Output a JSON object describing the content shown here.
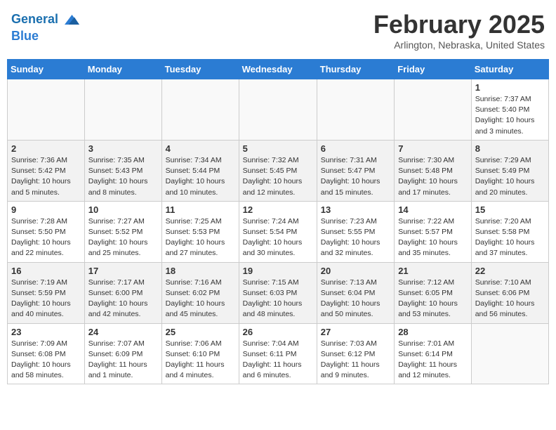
{
  "header": {
    "logo_line1": "General",
    "logo_line2": "Blue",
    "month": "February 2025",
    "location": "Arlington, Nebraska, United States"
  },
  "weekdays": [
    "Sunday",
    "Monday",
    "Tuesday",
    "Wednesday",
    "Thursday",
    "Friday",
    "Saturday"
  ],
  "weeks": [
    [
      {
        "day": "",
        "info": ""
      },
      {
        "day": "",
        "info": ""
      },
      {
        "day": "",
        "info": ""
      },
      {
        "day": "",
        "info": ""
      },
      {
        "day": "",
        "info": ""
      },
      {
        "day": "",
        "info": ""
      },
      {
        "day": "1",
        "info": "Sunrise: 7:37 AM\nSunset: 5:40 PM\nDaylight: 10 hours and 3 minutes."
      }
    ],
    [
      {
        "day": "2",
        "info": "Sunrise: 7:36 AM\nSunset: 5:42 PM\nDaylight: 10 hours and 5 minutes."
      },
      {
        "day": "3",
        "info": "Sunrise: 7:35 AM\nSunset: 5:43 PM\nDaylight: 10 hours and 8 minutes."
      },
      {
        "day": "4",
        "info": "Sunrise: 7:34 AM\nSunset: 5:44 PM\nDaylight: 10 hours and 10 minutes."
      },
      {
        "day": "5",
        "info": "Sunrise: 7:32 AM\nSunset: 5:45 PM\nDaylight: 10 hours and 12 minutes."
      },
      {
        "day": "6",
        "info": "Sunrise: 7:31 AM\nSunset: 5:47 PM\nDaylight: 10 hours and 15 minutes."
      },
      {
        "day": "7",
        "info": "Sunrise: 7:30 AM\nSunset: 5:48 PM\nDaylight: 10 hours and 17 minutes."
      },
      {
        "day": "8",
        "info": "Sunrise: 7:29 AM\nSunset: 5:49 PM\nDaylight: 10 hours and 20 minutes."
      }
    ],
    [
      {
        "day": "9",
        "info": "Sunrise: 7:28 AM\nSunset: 5:50 PM\nDaylight: 10 hours and 22 minutes."
      },
      {
        "day": "10",
        "info": "Sunrise: 7:27 AM\nSunset: 5:52 PM\nDaylight: 10 hours and 25 minutes."
      },
      {
        "day": "11",
        "info": "Sunrise: 7:25 AM\nSunset: 5:53 PM\nDaylight: 10 hours and 27 minutes."
      },
      {
        "day": "12",
        "info": "Sunrise: 7:24 AM\nSunset: 5:54 PM\nDaylight: 10 hours and 30 minutes."
      },
      {
        "day": "13",
        "info": "Sunrise: 7:23 AM\nSunset: 5:55 PM\nDaylight: 10 hours and 32 minutes."
      },
      {
        "day": "14",
        "info": "Sunrise: 7:22 AM\nSunset: 5:57 PM\nDaylight: 10 hours and 35 minutes."
      },
      {
        "day": "15",
        "info": "Sunrise: 7:20 AM\nSunset: 5:58 PM\nDaylight: 10 hours and 37 minutes."
      }
    ],
    [
      {
        "day": "16",
        "info": "Sunrise: 7:19 AM\nSunset: 5:59 PM\nDaylight: 10 hours and 40 minutes."
      },
      {
        "day": "17",
        "info": "Sunrise: 7:17 AM\nSunset: 6:00 PM\nDaylight: 10 hours and 42 minutes."
      },
      {
        "day": "18",
        "info": "Sunrise: 7:16 AM\nSunset: 6:02 PM\nDaylight: 10 hours and 45 minutes."
      },
      {
        "day": "19",
        "info": "Sunrise: 7:15 AM\nSunset: 6:03 PM\nDaylight: 10 hours and 48 minutes."
      },
      {
        "day": "20",
        "info": "Sunrise: 7:13 AM\nSunset: 6:04 PM\nDaylight: 10 hours and 50 minutes."
      },
      {
        "day": "21",
        "info": "Sunrise: 7:12 AM\nSunset: 6:05 PM\nDaylight: 10 hours and 53 minutes."
      },
      {
        "day": "22",
        "info": "Sunrise: 7:10 AM\nSunset: 6:06 PM\nDaylight: 10 hours and 56 minutes."
      }
    ],
    [
      {
        "day": "23",
        "info": "Sunrise: 7:09 AM\nSunset: 6:08 PM\nDaylight: 10 hours and 58 minutes."
      },
      {
        "day": "24",
        "info": "Sunrise: 7:07 AM\nSunset: 6:09 PM\nDaylight: 11 hours and 1 minute."
      },
      {
        "day": "25",
        "info": "Sunrise: 7:06 AM\nSunset: 6:10 PM\nDaylight: 11 hours and 4 minutes."
      },
      {
        "day": "26",
        "info": "Sunrise: 7:04 AM\nSunset: 6:11 PM\nDaylight: 11 hours and 6 minutes."
      },
      {
        "day": "27",
        "info": "Sunrise: 7:03 AM\nSunset: 6:12 PM\nDaylight: 11 hours and 9 minutes."
      },
      {
        "day": "28",
        "info": "Sunrise: 7:01 AM\nSunset: 6:14 PM\nDaylight: 11 hours and 12 minutes."
      },
      {
        "day": "",
        "info": ""
      }
    ]
  ]
}
